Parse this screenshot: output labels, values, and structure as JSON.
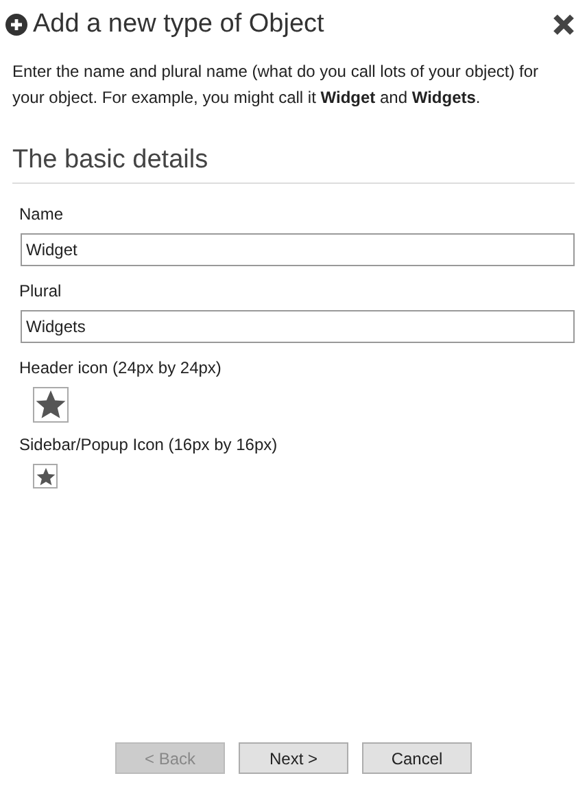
{
  "dialog": {
    "title": "Add a new type of Object",
    "intro": "Enter the name and plural name (what do you call lots of your object) for your object. For example, you might call it **Widget** and **Widgets**."
  },
  "section": {
    "heading": "The basic details"
  },
  "fields": [
    {
      "label": "Name",
      "value": "Widget"
    },
    {
      "label": "Plural",
      "value": "Widgets"
    }
  ],
  "icons": [
    {
      "label": "Header icon (24px by 24px)",
      "kind": "large"
    },
    {
      "label": "Sidebar/Popup Icon (16px by 16px)",
      "kind": "small"
    }
  ],
  "buttons": [
    {
      "label": "< Back",
      "disabled": true
    },
    {
      "label": "Next >",
      "disabled": false
    },
    {
      "label": "Cancel",
      "disabled": false
    }
  ]
}
